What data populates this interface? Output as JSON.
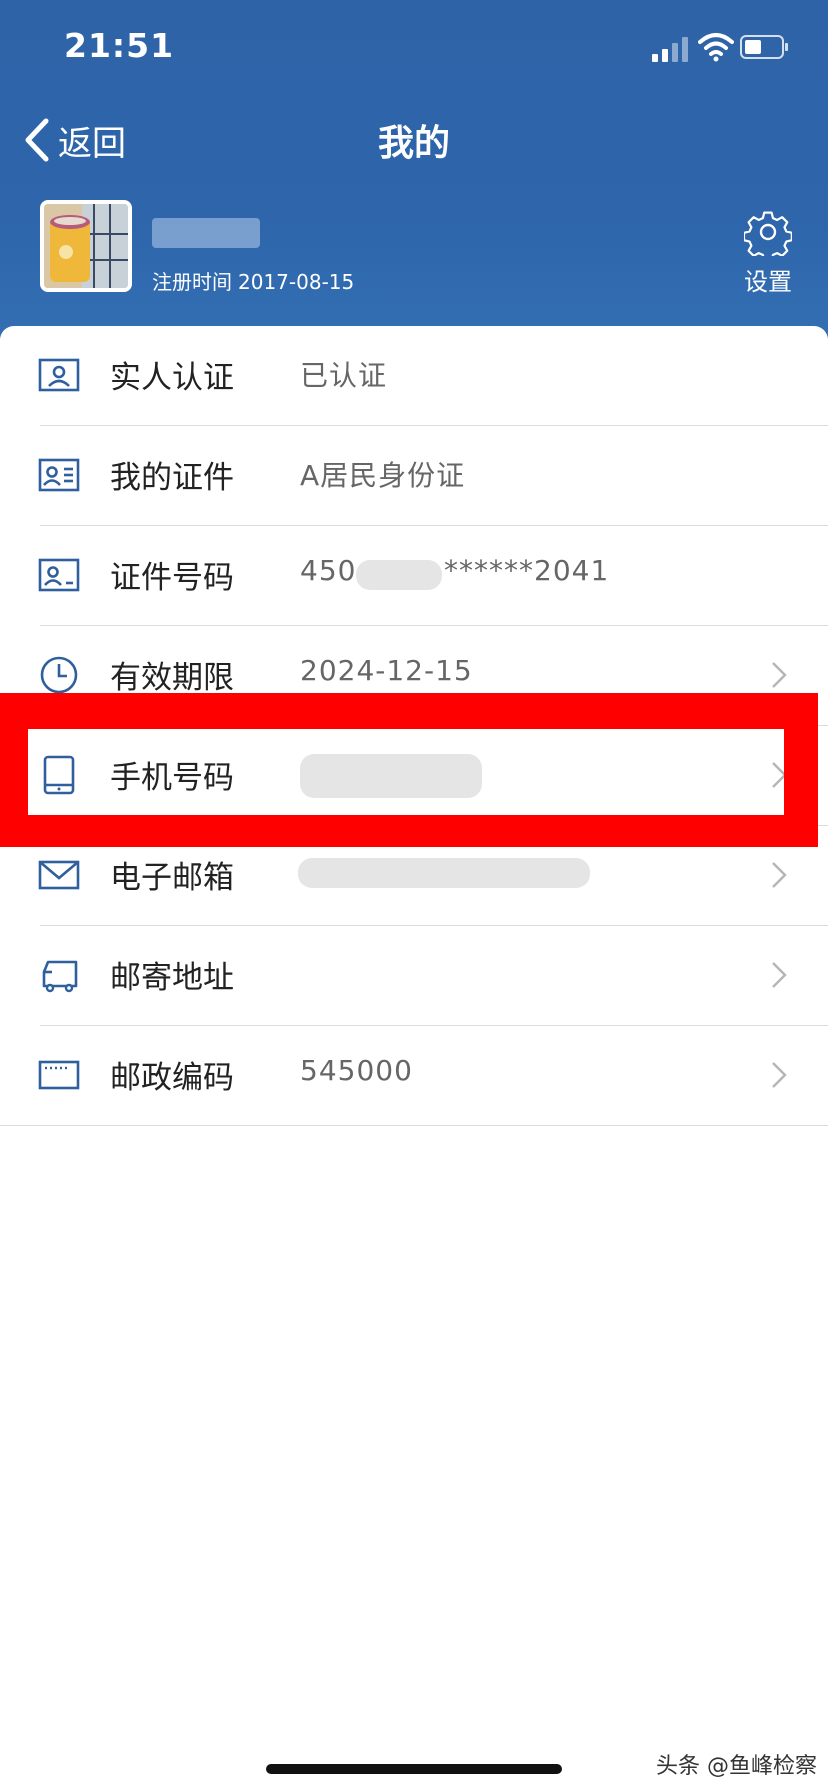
{
  "status_bar": {
    "time": "21:51"
  },
  "nav": {
    "back_label": "返回",
    "title": "我的"
  },
  "profile": {
    "registration_label": "注册时间",
    "registration_date": "2017-08-15",
    "settings_label": "设置"
  },
  "rows": [
    {
      "label": "实人认证",
      "value": "已认证",
      "icon": "person-card-icon",
      "chevron": false
    },
    {
      "label": "我的证件",
      "value": "A居民身份证",
      "icon": "id-card-icon",
      "chevron": false
    },
    {
      "label": "证件号码",
      "value_prefix": "450",
      "value_suffix": "******2041",
      "icon": "id-number-icon",
      "chevron": false
    },
    {
      "label": "有效期限",
      "value": "2024-12-15",
      "icon": "clock-icon",
      "chevron": true
    },
    {
      "label": "手机号码",
      "value": "",
      "icon": "phone-icon",
      "chevron": true
    },
    {
      "label": "电子邮箱",
      "value": "",
      "icon": "mail-icon",
      "chevron": true
    },
    {
      "label": "邮寄地址",
      "value": "",
      "icon": "truck-icon",
      "chevron": true
    },
    {
      "label": "邮政编码",
      "value": "545000",
      "icon": "postcode-icon",
      "chevron": true
    }
  ],
  "watermark": "头条 @鱼峰检察",
  "colors": {
    "header_blue": "#2f63a8",
    "icon_blue": "#2f5f9c",
    "highlight_red": "#ff0000"
  }
}
